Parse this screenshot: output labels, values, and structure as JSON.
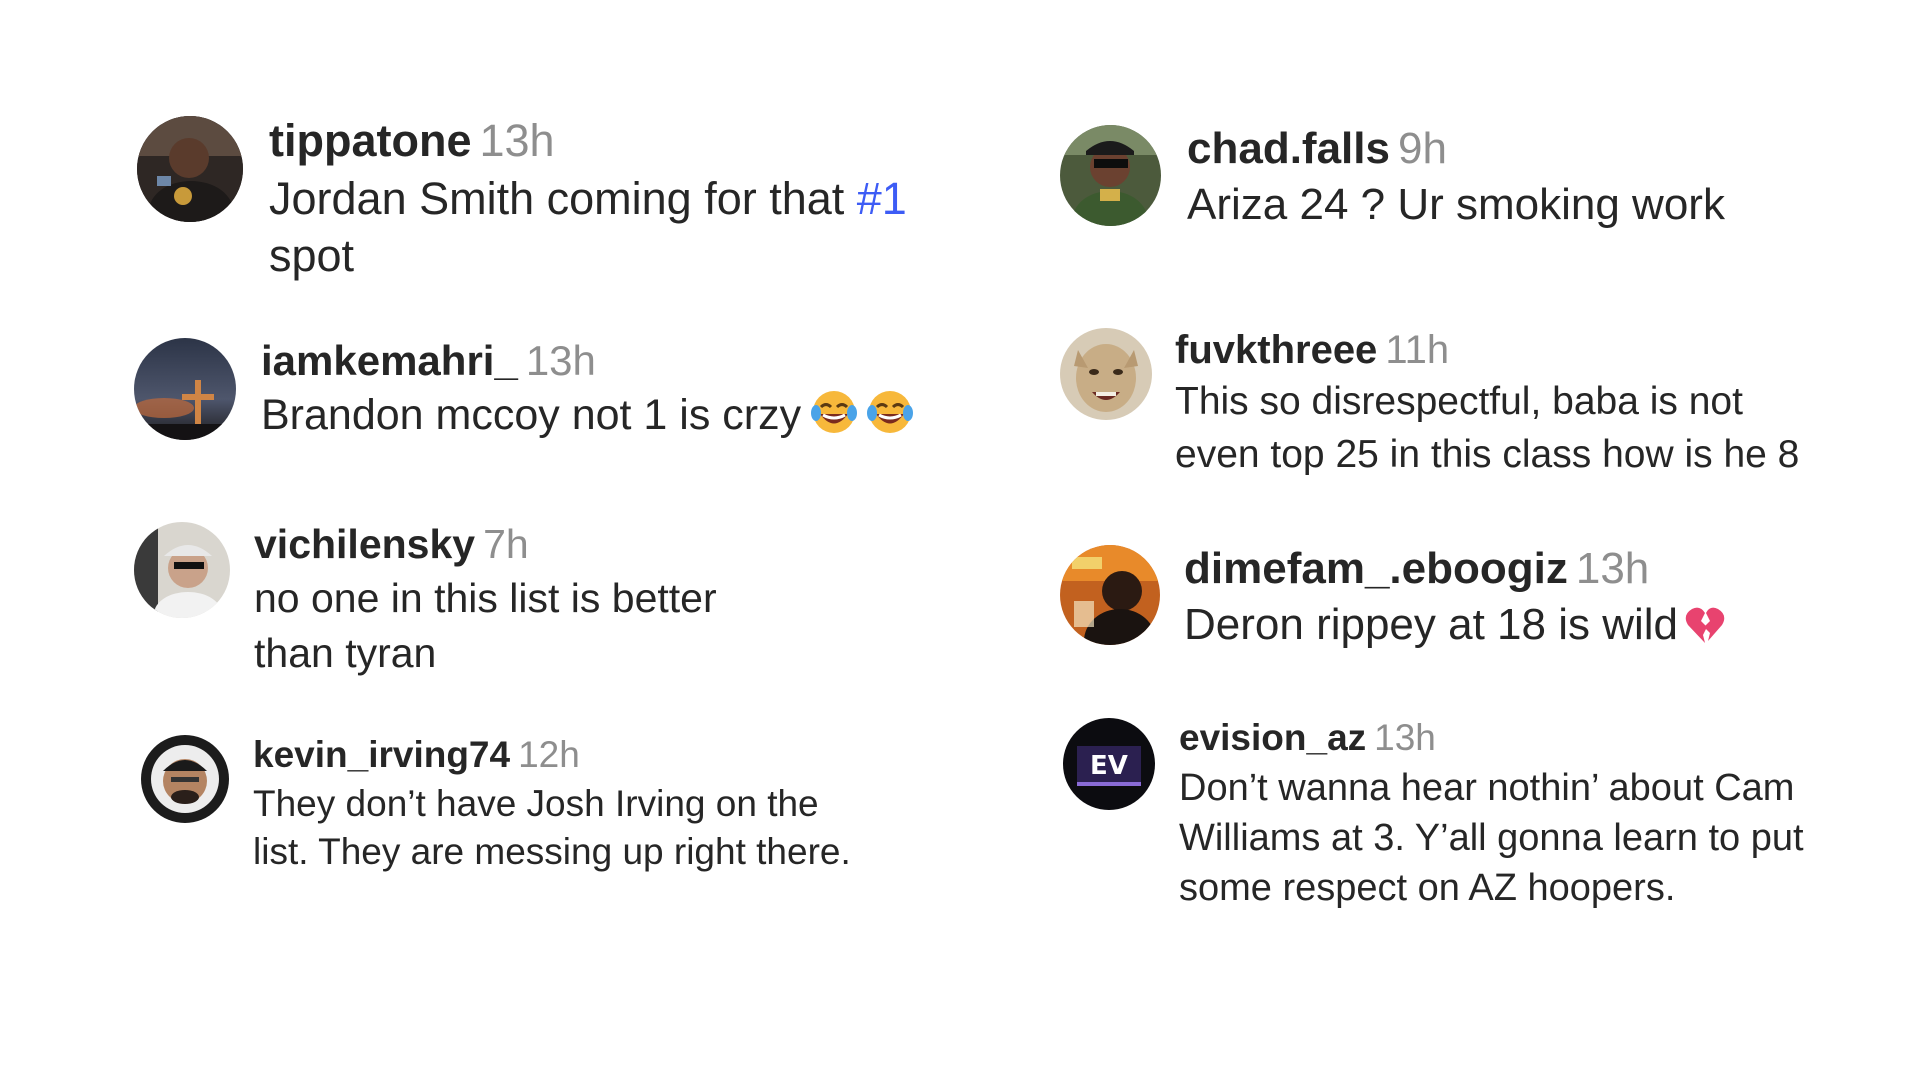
{
  "comments": [
    {
      "username": "tippatone",
      "time": "13h",
      "text_before": "Jordan Smith coming for that ",
      "hashtag": "#1",
      "text_after": " spot"
    },
    {
      "username": "iamkemahri_",
      "time": "13h",
      "text": "Brandon mccoy not 1 is crzy",
      "emojis": [
        "face-with-tears-of-joy-emoji",
        "face-with-tears-of-joy-emoji"
      ]
    },
    {
      "username": "vichilensky",
      "time": "7h",
      "text": "no one in this list is better than tyran"
    },
    {
      "username": "kevin_irving74",
      "time": "12h",
      "text": "They don’t have Josh Irving on the list. They are messing up right there."
    },
    {
      "username": "chad.falls",
      "time": "9h",
      "text": "Ariza 24 ? Ur smoking work"
    },
    {
      "username": "fuvkthreee",
      "time": "11h",
      "text": "This so disrespectful, baba is not even top 25 in this class how is he 8"
    },
    {
      "username": "dimefam_.eboogiz",
      "time": "13h",
      "text": "Deron rippey at 18 is wild",
      "emojis": [
        "broken-heart-emoji"
      ]
    },
    {
      "username": "evision_az",
      "time": "13h",
      "text": "Don’t wanna hear nothin’ about Cam Williams at 3. Y’all gonna learn to put some respect on AZ hoopers."
    }
  ],
  "colors": {
    "username": "#262626",
    "timestamp": "#8e8e8e",
    "hashtag": "#3d5cf5",
    "background": "#ffffff"
  }
}
